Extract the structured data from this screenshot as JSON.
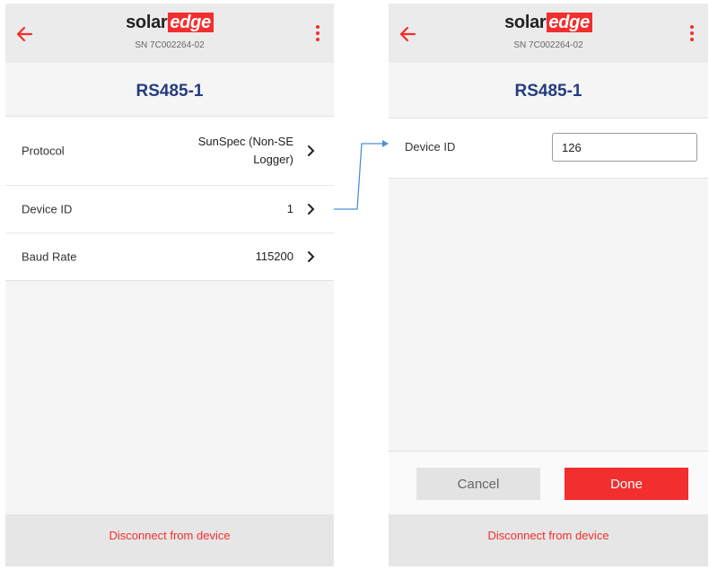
{
  "colors": {
    "brand_red": "#f22e2e",
    "title_blue": "#253b80",
    "connector_blue": "#4a90d9"
  },
  "left_screen": {
    "logo": {
      "solar": "solar",
      "edge": "edge"
    },
    "serial": "SN 7C002264-02",
    "title": "RS485-1",
    "rows": [
      {
        "label": "Protocol",
        "value_line1": "SunSpec (Non-SE",
        "value_line2": "Logger)"
      },
      {
        "label": "Device ID",
        "value": "1"
      },
      {
        "label": "Baud Rate",
        "value": "115200"
      }
    ],
    "footer": "Disconnect from device"
  },
  "right_screen": {
    "logo": {
      "solar": "solar",
      "edge": "edge"
    },
    "serial": "SN 7C002264-02",
    "title": "RS485-1",
    "field_label": "Device ID",
    "field_value": "126",
    "cancel_label": "Cancel",
    "done_label": "Done",
    "footer": "Disconnect from device"
  },
  "icons": {
    "back": "back-arrow-icon",
    "menu": "more-vertical-icon",
    "row_chevron": "chevron-right-icon"
  }
}
